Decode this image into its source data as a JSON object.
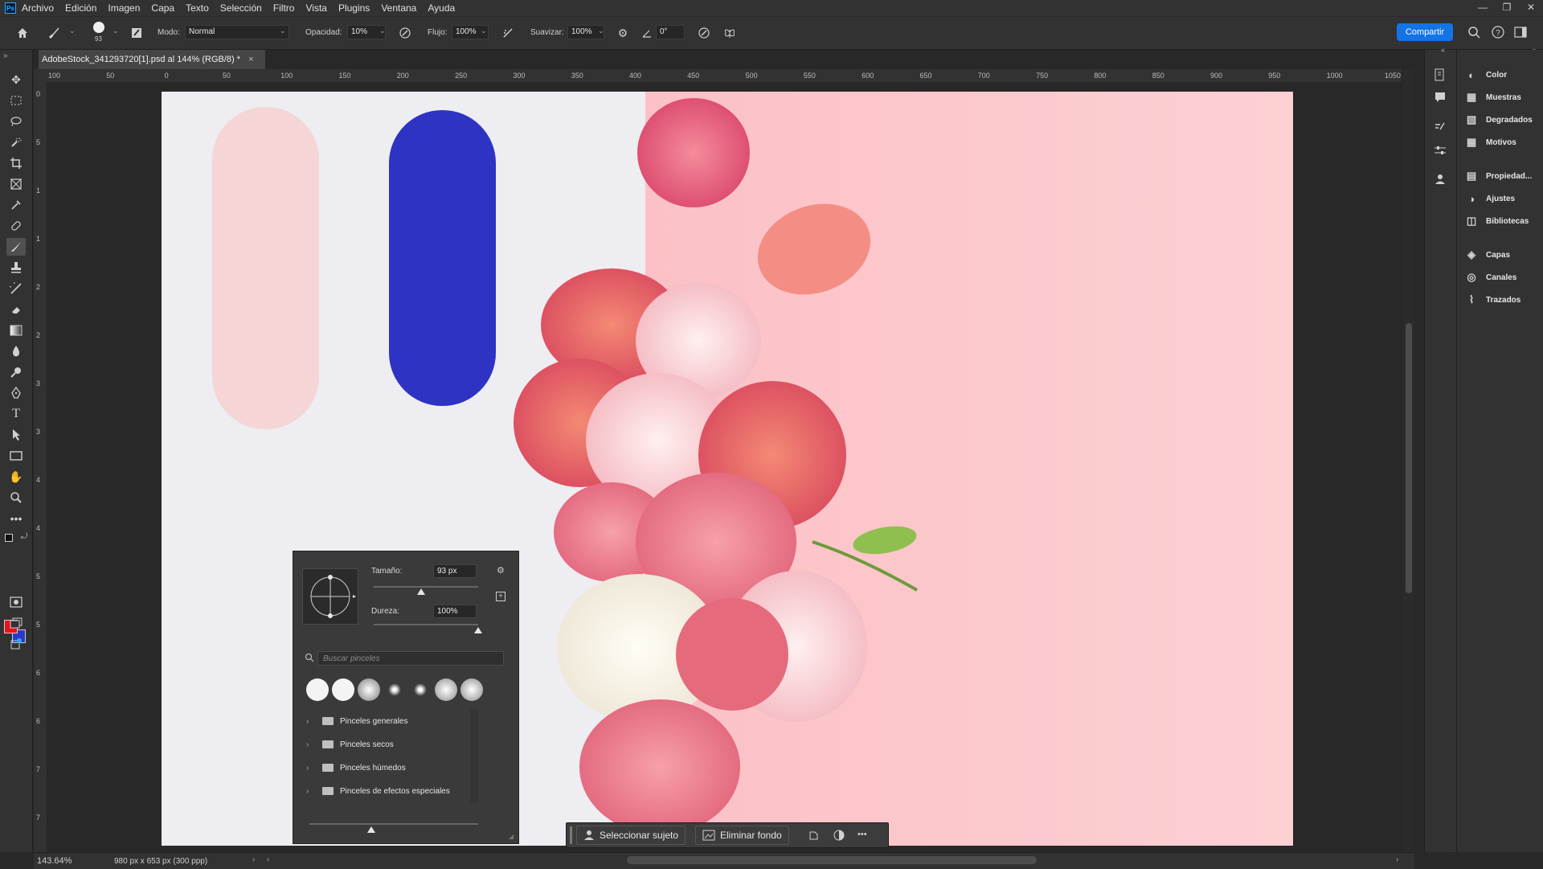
{
  "app": {
    "logo": "Ps",
    "menu": [
      "Archivo",
      "Edición",
      "Imagen",
      "Capa",
      "Texto",
      "Selección",
      "Filtro",
      "Vista",
      "Plugins",
      "Ventana",
      "Ayuda"
    ],
    "window_controls": [
      "—",
      "❐",
      "✕"
    ]
  },
  "options_bar": {
    "brush_size": "93",
    "mode_label": "Modo:",
    "mode_value": "Normal",
    "opacity_label": "Opacidad:",
    "opacity_value": "10%",
    "flow_label": "Flujo:",
    "flow_value": "100%",
    "smoothing_label": "Suavizar:",
    "smoothing_value": "100%",
    "angle_value": "0°",
    "share_label": "Compartir"
  },
  "document": {
    "tab_title": "AdobeStock_341293720[1].psd al 144% (RGB/8) *",
    "tab_close": "×"
  },
  "rulers": {
    "h_labels": [
      "100",
      "50",
      "0",
      "50",
      "100",
      "150",
      "200",
      "250",
      "300",
      "350",
      "400",
      "450",
      "500",
      "550",
      "600",
      "650",
      "700",
      "750",
      "800",
      "850",
      "900",
      "950",
      "1000",
      "1050"
    ],
    "v_labels": [
      "0",
      "5",
      "1",
      "1",
      "2",
      "2",
      "3",
      "3",
      "4",
      "4",
      "5",
      "5",
      "6",
      "6",
      "7",
      "7"
    ]
  },
  "right_panels": [
    {
      "label": "Color",
      "icon": "color-wheel-icon",
      "glyph": "◐"
    },
    {
      "label": "Muestras",
      "icon": "swatches-icon",
      "glyph": "▦"
    },
    {
      "label": "Degradados",
      "icon": "gradients-icon",
      "glyph": "▧"
    },
    {
      "label": "Motivos",
      "icon": "patterns-icon",
      "glyph": "▦"
    },
    {
      "label": "Propiedad...",
      "icon": "properties-icon",
      "glyph": "▤"
    },
    {
      "label": "Ajustes",
      "icon": "adjustments-icon",
      "glyph": "◑"
    },
    {
      "label": "Bibliotecas",
      "icon": "libraries-icon",
      "glyph": "◫"
    },
    {
      "label": "Capas",
      "icon": "layers-icon",
      "glyph": "◈"
    },
    {
      "label": "Canales",
      "icon": "channels-icon",
      "glyph": "◎"
    },
    {
      "label": "Trazados",
      "icon": "paths-icon",
      "glyph": "⌇"
    }
  ],
  "brush_popup": {
    "size_label": "Tamaño:",
    "size_value": "93 px",
    "size_fraction": 0.45,
    "hardness_label": "Dureza:",
    "hardness_value": "100%",
    "hardness_fraction": 1.0,
    "search_placeholder": "Buscar pinceles",
    "folders": [
      "Pinceles generales",
      "Pinceles secos",
      "Pinceles húmedos",
      "Pinceles de efectos especiales"
    ]
  },
  "contextual_taskbar": {
    "select_subject": "Seleccionar sujeto",
    "remove_background": "Eliminar fondo",
    "more": "•••"
  },
  "status_bar": {
    "zoom": "143.64%",
    "doc_info": "980 px x 653 px (300 ppp)"
  },
  "colors": {
    "foreground": "#e8141c",
    "background": "#2a3ac8",
    "accent": "#1473e6",
    "stroke_pink": "#f5d5d6",
    "stroke_blue": "#2e33c4",
    "canvas_pink": "#fcc6c9"
  }
}
